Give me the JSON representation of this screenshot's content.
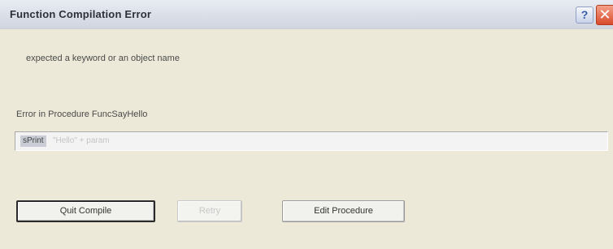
{
  "window": {
    "title": "Function Compilation Error",
    "help_label": "?",
    "close_label": "✕"
  },
  "dialog": {
    "message": "expected a keyword or an object name",
    "error_location": "Error in Procedure FuncSayHello",
    "code": {
      "keyword": "sPrint",
      "rest": "\"Hello\" + param"
    }
  },
  "buttons": {
    "quit_compile": "Quit Compile",
    "retry": "Retry",
    "edit_procedure": "Edit Procedure"
  },
  "colors": {
    "dialog_background": "#ece9d8",
    "close_button": "#d94a2c",
    "help_button": "#3a5ca8"
  }
}
